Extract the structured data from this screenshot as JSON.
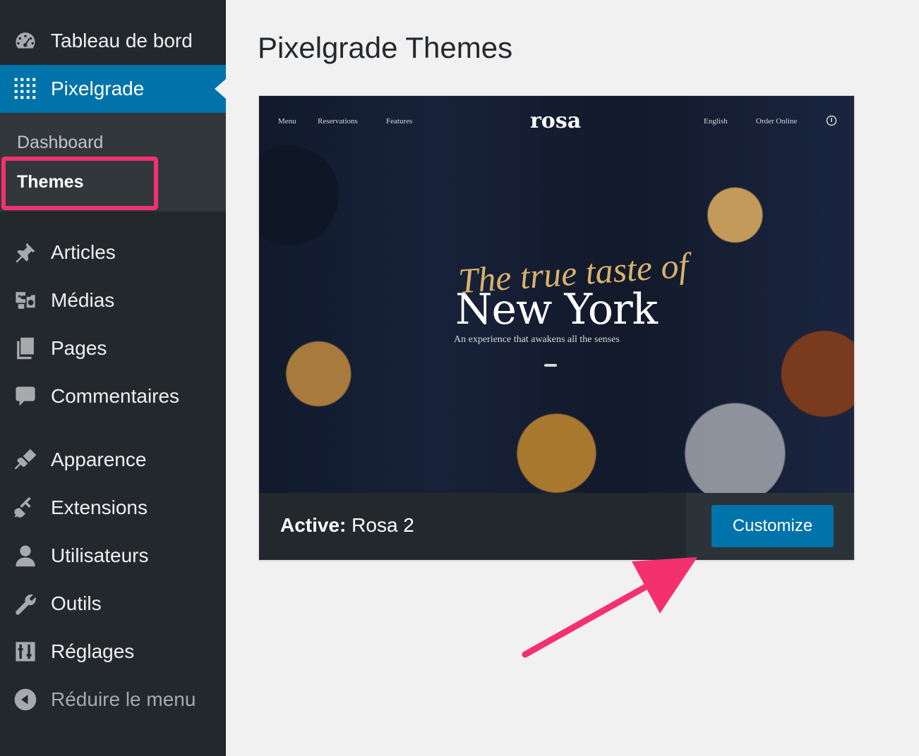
{
  "sidebar": {
    "items": [
      {
        "label": "Tableau de bord",
        "icon": "dashboard-icon"
      },
      {
        "label": "Pixelgrade",
        "icon": "grid-dots-icon"
      },
      {
        "label": "Articles",
        "icon": "pushpin-icon"
      },
      {
        "label": "Médias",
        "icon": "media-icon"
      },
      {
        "label": "Pages",
        "icon": "pages-icon"
      },
      {
        "label": "Commentaires",
        "icon": "comment-icon"
      },
      {
        "label": "Apparence",
        "icon": "paintbrush-icon"
      },
      {
        "label": "Extensions",
        "icon": "plugin-icon"
      },
      {
        "label": "Utilisateurs",
        "icon": "user-icon"
      },
      {
        "label": "Outils",
        "icon": "wrench-icon"
      },
      {
        "label": "Réglages",
        "icon": "settings-sliders-icon"
      }
    ],
    "submenu": [
      {
        "label": "Dashboard"
      },
      {
        "label": "Themes"
      }
    ],
    "collapse_label": "Réduire le menu"
  },
  "main": {
    "title": "Pixelgrade Themes",
    "theme": {
      "active_prefix": "Active:",
      "active_name": " Rosa 2",
      "customize_label": "Customize",
      "screenshot": {
        "nav_left": [
          "Menu",
          "Reservations",
          "Features"
        ],
        "logo": "rosa",
        "nav_right": [
          "English",
          "Order Online"
        ],
        "script_line": "The true taste of",
        "headline": "New York",
        "subline": "An experience that awakens all the senses"
      }
    }
  },
  "colors": {
    "accent": "#0073aa",
    "highlight": "#f4306f",
    "sidebar_bg": "#23282d"
  }
}
